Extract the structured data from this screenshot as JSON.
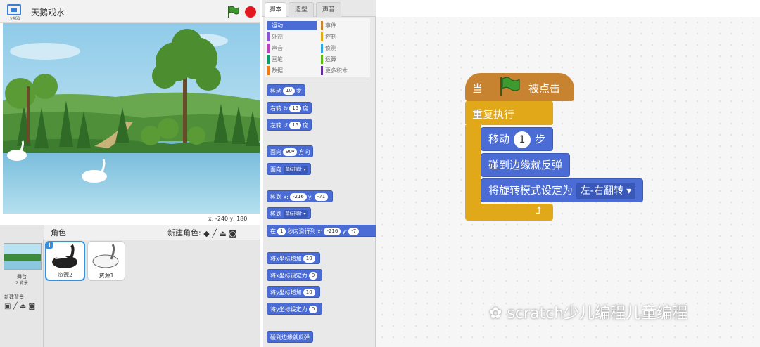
{
  "header": {
    "version": "v461",
    "project_title": "天鹅戏水"
  },
  "stage": {
    "coords": "x: -240  y: 180"
  },
  "sprites": {
    "label": "角色",
    "new_sprite_label": "新建角色:",
    "stage_name": "舞台",
    "stage_count": "2 背景",
    "new_backdrop_label": "新建背景",
    "items": [
      {
        "name": "资源2"
      },
      {
        "name": "资源1"
      }
    ],
    "info": "i"
  },
  "tabs": [
    "脚本",
    "造型",
    "声音"
  ],
  "categories": [
    {
      "label": "运动",
      "color": "#4a6cd4"
    },
    {
      "label": "事件",
      "color": "#c88330"
    },
    {
      "label": "外观",
      "color": "#8a55d7"
    },
    {
      "label": "控制",
      "color": "#e1a91a"
    },
    {
      "label": "声音",
      "color": "#bb42c3"
    },
    {
      "label": "侦测",
      "color": "#2ca5e2"
    },
    {
      "label": "画笔",
      "color": "#0e9a6c"
    },
    {
      "label": "运算",
      "color": "#5cb712"
    },
    {
      "label": "数据",
      "color": "#ee7d16"
    },
    {
      "label": "更多积木",
      "color": "#632d99"
    }
  ],
  "palette": {
    "move": {
      "pre": "移动",
      "val": "10",
      "post": "步"
    },
    "turn_right": {
      "pre": "右转",
      "val": "15",
      "post": "度"
    },
    "turn_left": {
      "pre": "左转",
      "val": "15",
      "post": "度"
    },
    "point_dir": {
      "pre": "面向",
      "val": "90▾",
      "post": "方向"
    },
    "point_towards": {
      "pre": "面向",
      "dd": "鼠标指针 ▾"
    },
    "goto_xy": {
      "pre": "移到 x:",
      "x": "-216",
      "mid": "y:",
      "y": "-71"
    },
    "goto": {
      "pre": "移到",
      "dd": "鼠标指针 ▾"
    },
    "glide": {
      "pre": "在",
      "secs": "1",
      "mid": "秒内滑行到 x:",
      "x": "-216",
      "mid2": "y:",
      "y": "-7"
    },
    "change_x": {
      "pre": "将x坐标增加",
      "val": "10"
    },
    "set_x": {
      "pre": "将x坐标设定为",
      "val": "0"
    },
    "change_y": {
      "pre": "将y坐标增加",
      "val": "10"
    },
    "set_y": {
      "pre": "将y坐标设定为",
      "val": "0"
    },
    "bounce": {
      "label": "碰到边缘就反弹"
    }
  },
  "script": {
    "hat_pre": "当",
    "hat_post": "被点击",
    "forever": "重复执行",
    "move_pre": "移动",
    "move_val": "1",
    "move_post": "步",
    "bounce": "碰到边缘就反弹",
    "rot_pre": "将旋转模式设定为",
    "rot_val": "左-右翻转"
  },
  "watermark": "scratch少儿编程儿童编程"
}
